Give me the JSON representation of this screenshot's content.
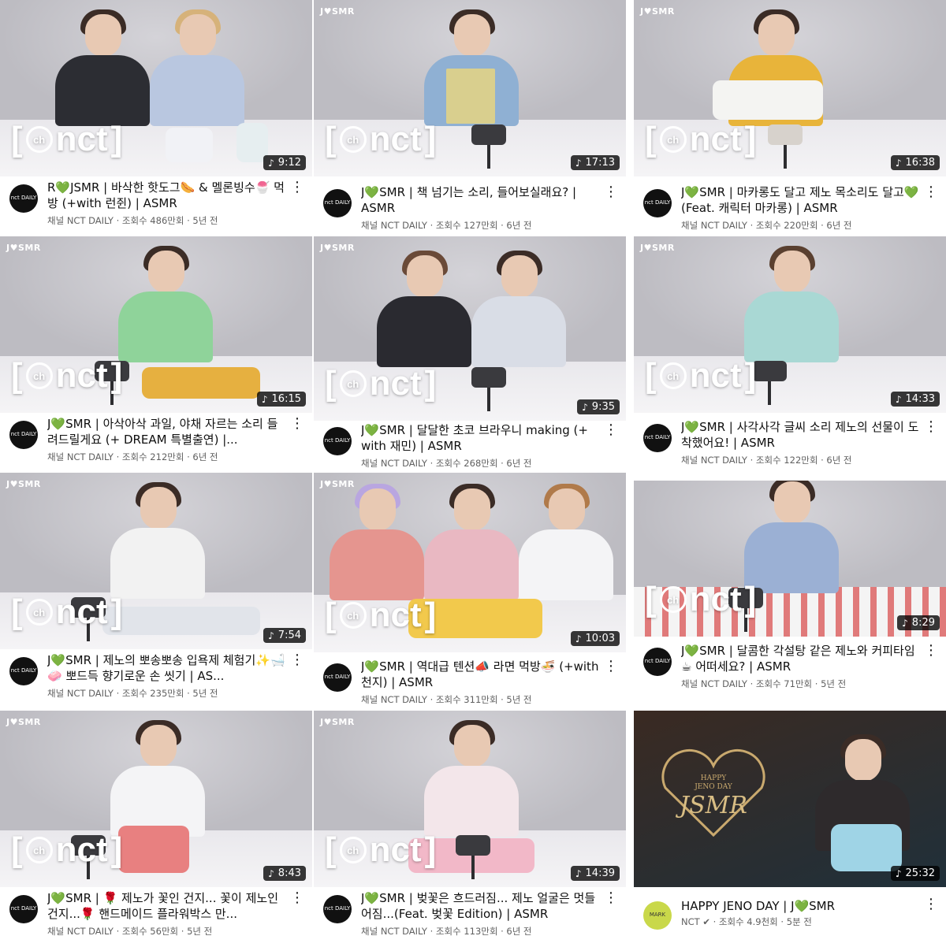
{
  "videos": [
    {
      "title": "R💚JSMR | 바삭한 핫도그🌭 & 멜론빙수🍧 먹방 (+with 런쥔) | ASMR",
      "meta": "채널 NCT DAILY · 조회수 486만회 · 5년 전",
      "duration": "9:12",
      "channel_avatar": "nct DAILY"
    },
    {
      "title": "J💚SMR | 책 넘기는 소리, 들어보실래요? | ASMR",
      "meta": "채널 NCT DAILY · 조회수 127만회 · 6년 전",
      "duration": "17:13",
      "channel_avatar": "nct DAILY"
    },
    {
      "title": "J💚SMR | 마카롱도 달고 제노 목소리도 달고💚 (Feat. 캐릭터 마카롱) | ASMR",
      "meta": "채널 NCT DAILY · 조회수 220만회 · 6년 전",
      "duration": "16:38",
      "channel_avatar": "nct DAILY"
    },
    {
      "title": "J💚SMR | 아삭아삭 과일, 야채 자르는 소리 들려드릴게요 (+ DREAM 특별출연) |...",
      "meta": "채널 NCT DAILY · 조회수 212만회 · 6년 전",
      "duration": "16:15",
      "channel_avatar": "nct DAILY"
    },
    {
      "title": "J💚SMR | 달달한 초코 브라우니 making (+ with 재민) | ASMR",
      "meta": "채널 NCT DAILY · 조회수 268만회 · 6년 전",
      "duration": "9:35",
      "channel_avatar": "nct DAILY"
    },
    {
      "title": "J💚SMR | 사각사각 글씨 소리 제노의 선물이 도착했어요! | ASMR",
      "meta": "채널 NCT DAILY · 조회수 122만회 · 6년 전",
      "duration": "14:33",
      "channel_avatar": "nct DAILY"
    },
    {
      "title": "J💚SMR | 제노의 뽀송뽀송 입욕제 체험기✨🛁🧼 뽀드득 향기로운 손 씻기 | AS...",
      "meta": "채널 NCT DAILY · 조회수 235만회 · 5년 전",
      "duration": "7:54",
      "channel_avatar": "nct DAILY"
    },
    {
      "title": "J💚SMR | 역대급 텐션📣 라면 먹방🍜 (+with 천지) | ASMR",
      "meta": "채널 NCT DAILY · 조회수 311만회 · 5년 전",
      "duration": "10:03",
      "channel_avatar": "nct DAILY"
    },
    {
      "title": "J💚SMR | 달콤한 각설탕 같은 제노와 커피타임☕ 어떠세요? | ASMR",
      "meta": "채널 NCT DAILY · 조회수 71만회 · 5년 전",
      "duration": "8:29",
      "channel_avatar": "nct DAILY"
    },
    {
      "title": "J💚SMR | 🌹 제노가 꽃인 건지... 꽃이 제노인 건지...🌹 핸드메이드 플라워박스 만...",
      "meta": "채널 NCT DAILY · 조회수 56만회 · 5년 전",
      "duration": "8:43",
      "channel_avatar": "nct DAILY"
    },
    {
      "title": "J💚SMR | 벚꽃은 흐드러짐... 제노 얼굴은 멋들어짐...(Feat. 벚꽃 Edition) | ASMR",
      "meta": "채널 NCT DAILY · 조회수 113만회 · 6년 전",
      "duration": "14:39",
      "channel_avatar": "nct DAILY"
    },
    {
      "title": "HAPPY JENO DAY | J💚SMR",
      "meta": "NCT ✔ · 조회수 4.9천회 · 5분 전",
      "duration": "25:32",
      "channel_avatar": "MARK"
    }
  ],
  "thumb_brand": "J♥SMR",
  "watermark": {
    "ch": "ch",
    "text": "nct"
  },
  "final_logo": {
    "line1": "HAPPY",
    "line2": "JENO DAY",
    "main": "JSMR"
  },
  "more_icon": "⋮",
  "music_icon": "♪",
  "colors": {
    "text": "#0f0f0f",
    "meta": "#606060",
    "duration_bg": "#000000"
  }
}
